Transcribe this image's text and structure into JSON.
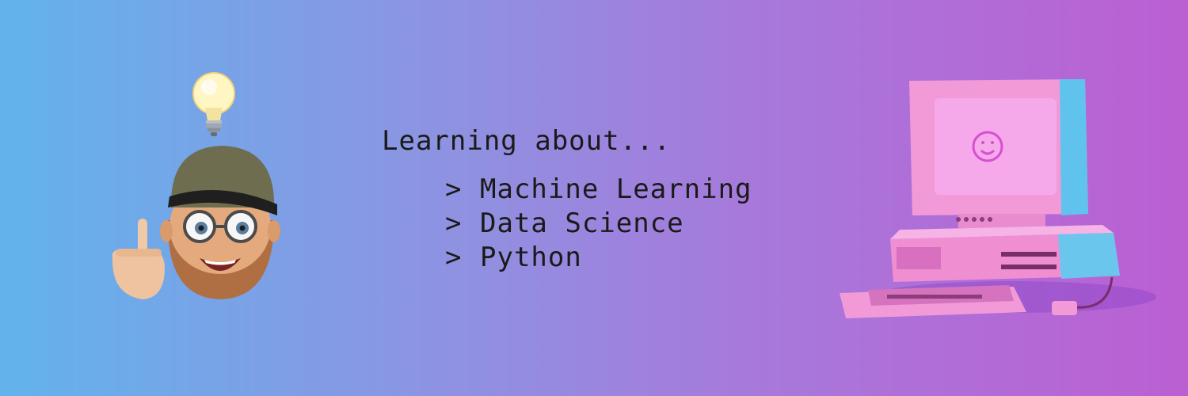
{
  "banner": {
    "headline": "Learning about...",
    "caret": ">",
    "topics": [
      "Machine Learning",
      "Data Science",
      "Python"
    ],
    "colors": {
      "gradient_start": "#62b3ec",
      "gradient_mid": "#a67adb",
      "gradient_end": "#bb5fd3",
      "text": "#1a1a1a"
    }
  },
  "illustrations": {
    "left": {
      "icon": "memoji-lightbulb-icon"
    },
    "right": {
      "icon": "retro-computer-icon",
      "screen_icon": "smiley-icon"
    }
  }
}
